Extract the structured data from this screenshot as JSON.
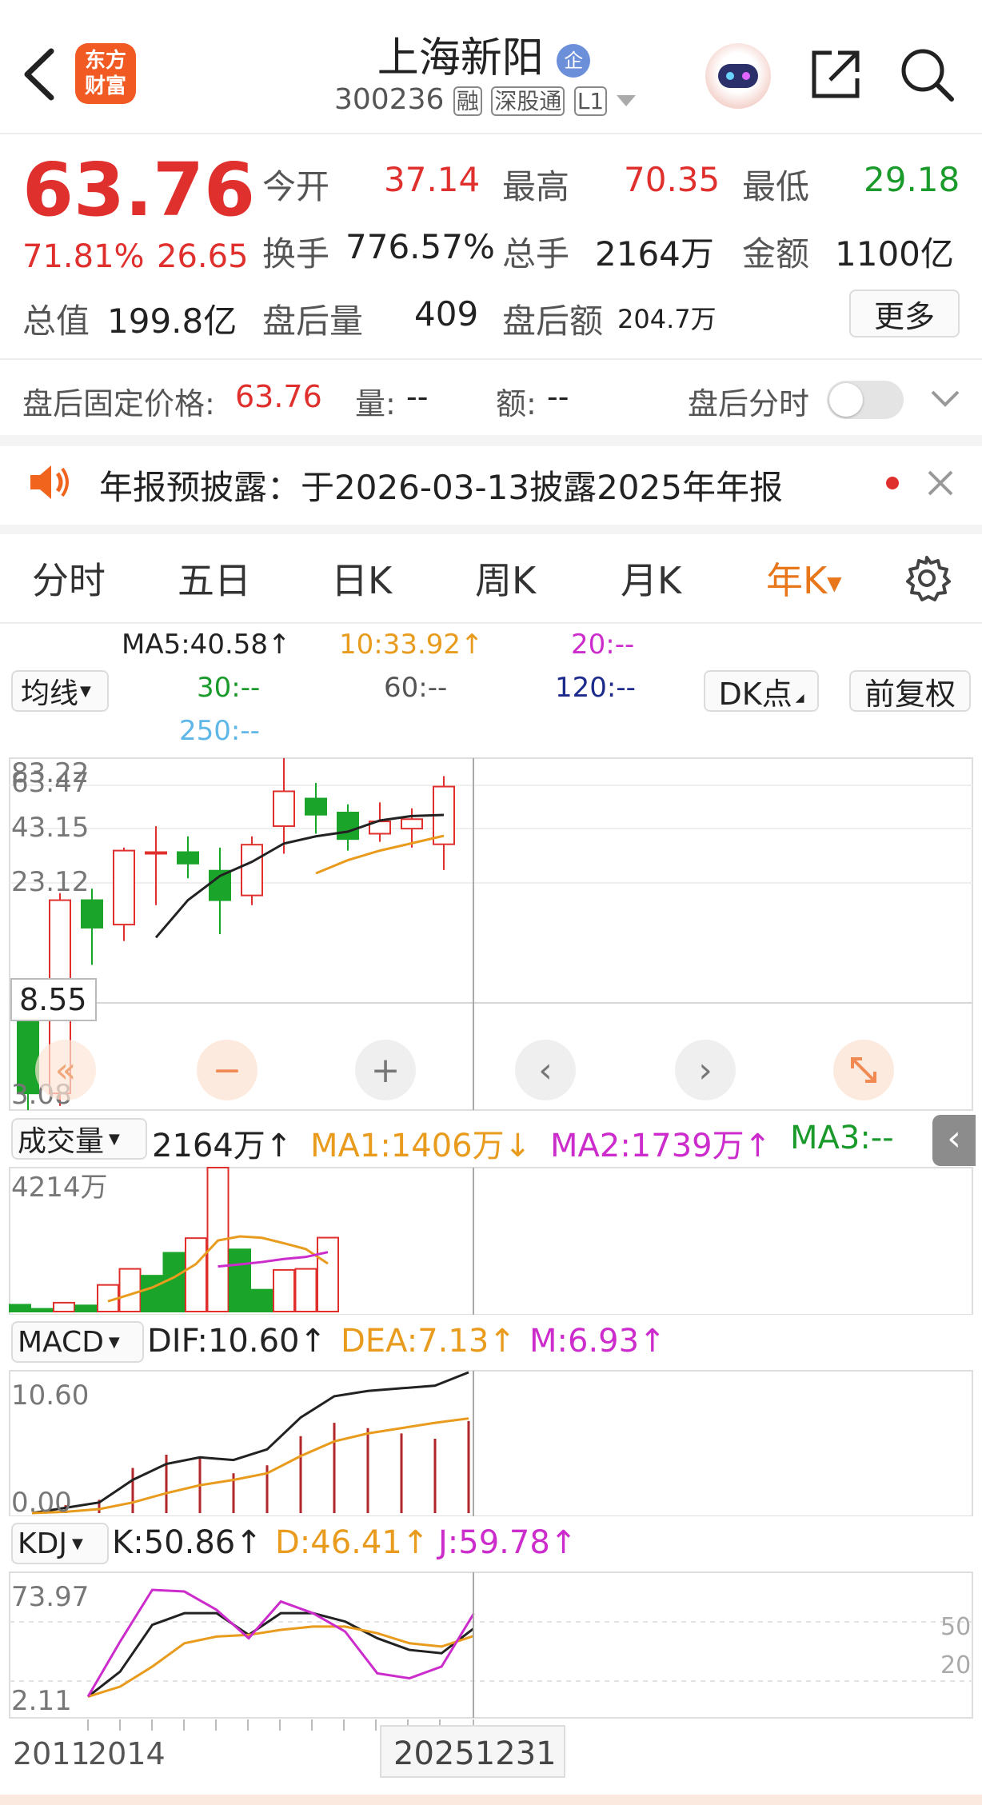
{
  "header": {
    "title": "上海新阳",
    "badge": "企",
    "logo_line1": "东方",
    "logo_line2": "财富",
    "code": "300236",
    "tag_rong": "融",
    "tag_sgt": "深股通",
    "tag_level": "L1"
  },
  "quote": {
    "price": "63.76",
    "change_pct": "71.81%",
    "change_amt": "26.65",
    "open_label": "今开",
    "open": "37.14",
    "high_label": "最高",
    "high": "70.35",
    "low_label": "最低",
    "low": "29.18",
    "turnover_label": "换手",
    "turnover": "776.57%",
    "volume_label": "总手",
    "volume": "2164万",
    "amount_label": "金额",
    "amount": "1100亿",
    "mktcap_label": "总值",
    "mktcap": "199.8亿",
    "ah_vol_label": "盘后量",
    "ah_vol": "409",
    "ah_amt_label": "盘后额",
    "ah_amt": "204.7万",
    "more_label": "更多"
  },
  "after_hours": {
    "price_label": "盘后固定价格:",
    "price": "63.76",
    "vol_label": "量:",
    "vol": "--",
    "amt_label": "额:",
    "amt": "--",
    "toggle_label": "盘后分时",
    "toggle_on": false
  },
  "notice": {
    "text": "年报预披露：于2026-03-13披露2025年年报"
  },
  "tabs": {
    "items": [
      "分时",
      "五日",
      "日K",
      "周K",
      "月K",
      "年K"
    ],
    "active": "年K"
  },
  "ma_bar": {
    "selector": "均线",
    "ma5": "MA5:40.58↑",
    "ma10": "10:33.92↑",
    "ma20": "20:--",
    "ma30": "30:--",
    "ma60": "60:--",
    "ma120": "120:--",
    "ma250": "250:--",
    "dk_label": "DK点",
    "fq_label": "前复权"
  },
  "kline_axis": {
    "top1": "83.22",
    "top2": "63.47",
    "l1": "43.15",
    "l2": "23.12",
    "l3": "8.55",
    "l4": "3.08"
  },
  "volume_bar": {
    "selector": "成交量",
    "vol": "2164万↑",
    "ma1": "MA1:1406万↓",
    "ma2": "MA2:1739万↑",
    "ma3": "MA3:--",
    "axis_max": "4214万"
  },
  "macd_bar": {
    "selector": "MACD",
    "dif": "DIF:10.60↑",
    "dea": "DEA:7.13↑",
    "m": "M:6.93↑",
    "axis_max": "10.60",
    "axis_min": "0.00"
  },
  "kdj_bar": {
    "selector": "KDJ",
    "k": "K:50.86↑",
    "d": "D:46.41↑",
    "j": "J:59.78↑",
    "axis_max": "73.97",
    "axis_min": "2.11",
    "ref50": "50",
    "ref20": "20"
  },
  "dates": {
    "left1": "2011",
    "left2": "2014",
    "cursor": "20251231"
  },
  "colors": {
    "up": "#e0302e",
    "down": "#1aa52a",
    "ma5": "#222222",
    "ma10": "#e89b1c",
    "ma20": "#cc2ccc",
    "accent": "#e8771c"
  },
  "chart_data": [
    {
      "type": "candlestick",
      "title": "年K",
      "candles": [
        {
          "o": 8.0,
          "h": 10.0,
          "l": 3.08,
          "c": 3.6
        },
        {
          "o": 3.6,
          "h": 23.5,
          "l": 3.2,
          "c": 22.0
        },
        {
          "o": 22.0,
          "h": 24.5,
          "l": 12.0,
          "c": 17.0
        },
        {
          "o": 17.5,
          "h": 36.0,
          "l": 15.0,
          "c": 35.0
        },
        {
          "o": 34.5,
          "h": 44.0,
          "l": 21.0,
          "c": 34.5
        },
        {
          "o": 34.5,
          "h": 40.0,
          "l": 27.0,
          "c": 31.0
        },
        {
          "o": 29.0,
          "h": 36.0,
          "l": 16.0,
          "c": 22.0
        },
        {
          "o": 23.0,
          "h": 40.0,
          "l": 21.0,
          "c": 37.0
        },
        {
          "o": 44.0,
          "h": 83.22,
          "l": 34.0,
          "c": 61.0
        },
        {
          "o": 57.0,
          "h": 66.0,
          "l": 41.0,
          "c": 49.0
        },
        {
          "o": 50.0,
          "h": 54.0,
          "l": 35.0,
          "c": 39.0
        },
        {
          "o": 41.0,
          "h": 55.0,
          "l": 38.0,
          "c": 46.0
        },
        {
          "o": 43.0,
          "h": 52.0,
          "l": 36.0,
          "c": 47.0
        },
        {
          "o": 37.14,
          "h": 70.35,
          "l": 29.18,
          "c": 63.76
        }
      ],
      "ma5": [
        null,
        null,
        null,
        null,
        15.5,
        22.0,
        27.6,
        31.5,
        37.4,
        40.0,
        41.8,
        46.4,
        48.4,
        48.9
      ],
      "ma10": [
        null,
        null,
        null,
        null,
        null,
        null,
        null,
        null,
        null,
        28.3,
        32.0,
        35.0,
        37.5,
        40.2
      ]
    },
    {
      "type": "bar",
      "title": "成交量",
      "unit": "万",
      "values": [
        200,
        80,
        260,
        180,
        780,
        1250,
        1050,
        1720,
        2150,
        4214,
        1820,
        640,
        1220,
        1250,
        2164
      ],
      "up": [
        false,
        false,
        true,
        false,
        true,
        true,
        false,
        false,
        true,
        true,
        false,
        false,
        true,
        true,
        true
      ],
      "ma1": [
        null,
        null,
        null,
        null,
        300,
        500,
        700,
        1000,
        1390,
        2080,
        2200,
        2160,
        2000,
        1830,
        1406
      ],
      "ma2": [
        null,
        null,
        null,
        null,
        null,
        null,
        null,
        null,
        null,
        1320,
        1380,
        1450,
        1540,
        1600,
        1739
      ]
    },
    {
      "type": "bar",
      "title": "MACD",
      "dif": [
        0.0,
        0.4,
        0.8,
        2.5,
        3.7,
        4.2,
        4.0,
        4.8,
        7.2,
        8.8,
        9.2,
        9.4,
        9.6,
        10.6
      ],
      "dea": [
        0.0,
        0.1,
        0.3,
        0.8,
        1.5,
        2.1,
        2.5,
        3.0,
        4.3,
        5.4,
        6.0,
        6.4,
        6.8,
        7.13
      ],
      "m": [
        0.0,
        0.6,
        1.0,
        3.4,
        4.4,
        4.2,
        3.0,
        3.6,
        5.8,
        6.8,
        6.4,
        6.0,
        5.6,
        6.93
      ]
    },
    {
      "type": "line",
      "title": "KDJ",
      "k": [
        10,
        25,
        53,
        60,
        60,
        47,
        60,
        60,
        55,
        45,
        38,
        36,
        50.86
      ],
      "d": [
        10,
        16,
        28,
        42,
        46,
        47,
        50,
        52,
        52,
        48,
        42,
        40,
        46.41
      ],
      "j": [
        10,
        43,
        73.97,
        73,
        62,
        45,
        67,
        60,
        49,
        24,
        21,
        28,
        59.78
      ]
    }
  ]
}
